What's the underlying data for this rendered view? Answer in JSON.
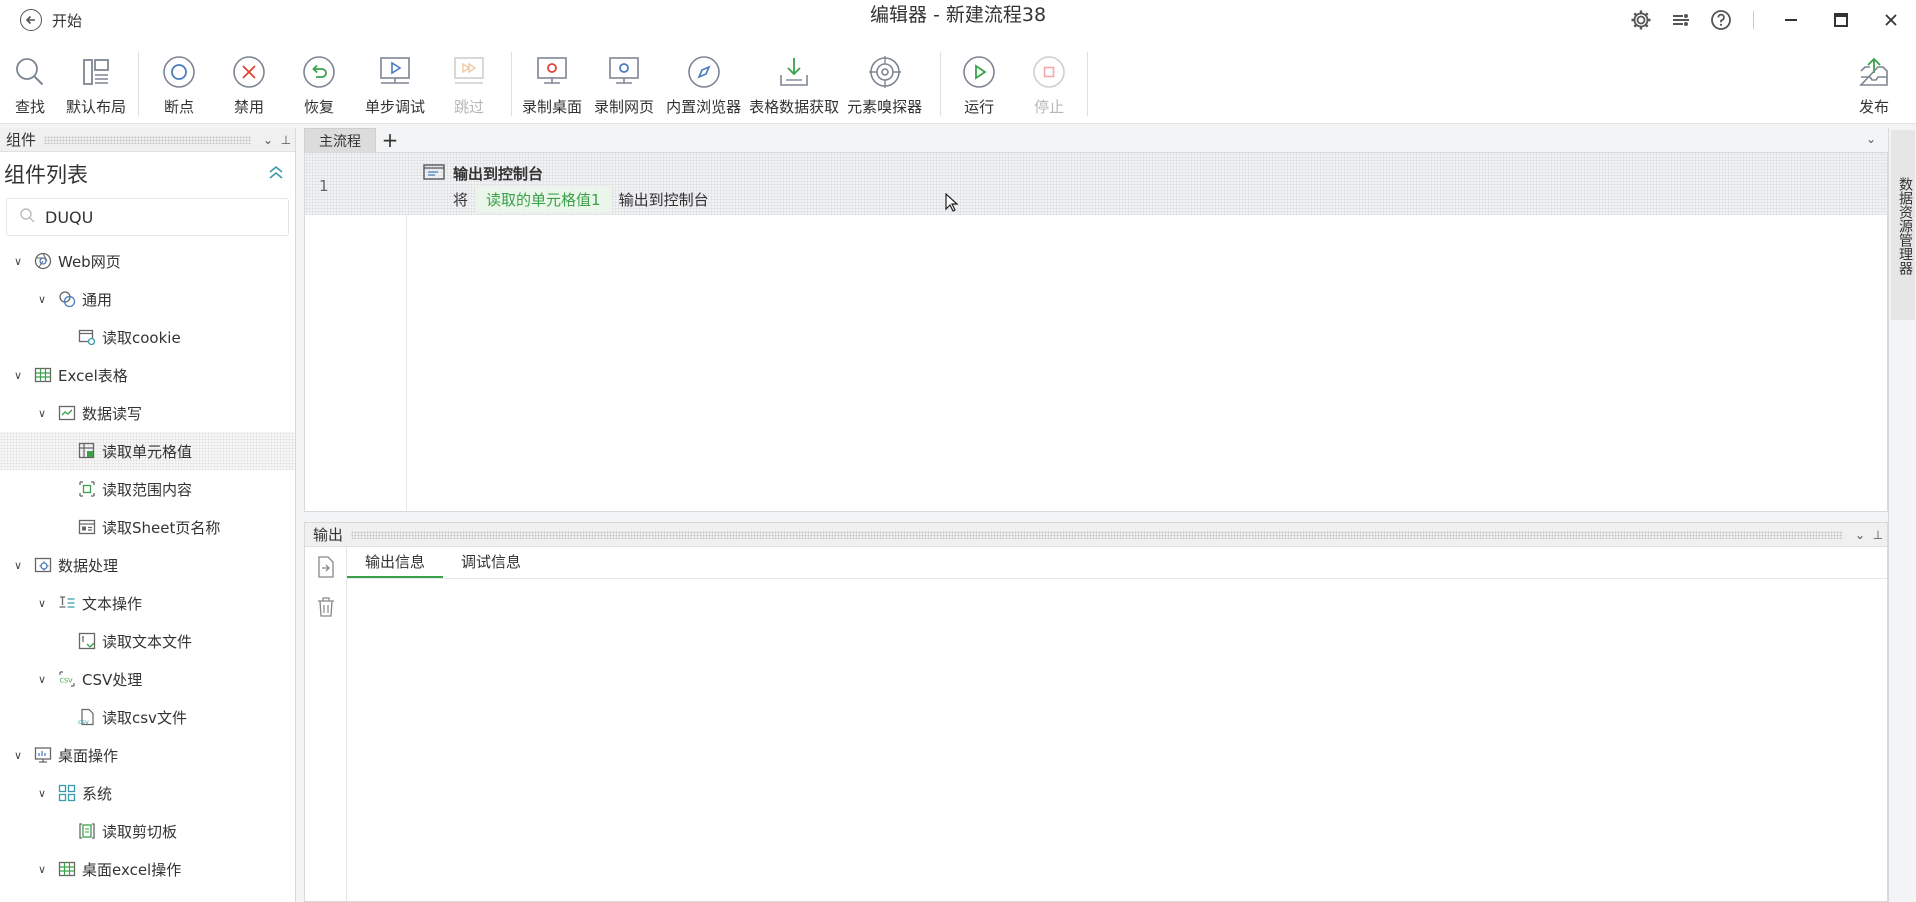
{
  "titlebar": {
    "back_label": "开始",
    "window_title": "编辑器 - 新建流程38"
  },
  "toolbar": {
    "find": "查找",
    "default_layout": "默认布局",
    "breakpoint": "断点",
    "disable": "禁用",
    "restore": "恢复",
    "step_debug": "单步调试",
    "skip": "跳过",
    "record_desktop": "录制桌面",
    "record_web": "录制网页",
    "builtin_browser": "内置浏览器",
    "table_fetch": "表格数据获取",
    "element_sniffer": "元素嗅探器",
    "run": "运行",
    "stop": "停止",
    "publish": "发布"
  },
  "left_panel": {
    "header": "组件",
    "title": "组件列表",
    "search_value": "DUQU",
    "tree": [
      {
        "label": "Web网页",
        "level": 0,
        "icon": "web-icon"
      },
      {
        "label": "通用",
        "level": 1,
        "icon": "general-icon"
      },
      {
        "label": "读取cookie",
        "level": 2,
        "icon": "cookie-icon"
      },
      {
        "label": "Excel表格",
        "level": 0,
        "icon": "excel-icon"
      },
      {
        "label": "数据读写",
        "level": 1,
        "icon": "data-rw-icon"
      },
      {
        "label": "读取单元格值",
        "level": 2,
        "icon": "cell-icon"
      },
      {
        "label": "读取范围内容",
        "level": 2,
        "icon": "range-icon"
      },
      {
        "label": "读取Sheet页名称",
        "level": 2,
        "icon": "sheet-icon"
      },
      {
        "label": "数据处理",
        "level": 0,
        "icon": "data-process-icon"
      },
      {
        "label": "文本操作",
        "level": 1,
        "icon": "text-op-icon"
      },
      {
        "label": "读取文本文件",
        "level": 2,
        "icon": "text-file-icon"
      },
      {
        "label": "CSV处理",
        "level": 1,
        "icon": "csv-icon"
      },
      {
        "label": "读取csv文件",
        "level": 2,
        "icon": "csv-file-icon"
      },
      {
        "label": "桌面操作",
        "level": 0,
        "icon": "desktop-icon"
      },
      {
        "label": "系统",
        "level": 1,
        "icon": "system-icon"
      },
      {
        "label": "读取剪切板",
        "level": 2,
        "icon": "clipboard-icon"
      },
      {
        "label": "桌面excel操作",
        "level": 1,
        "icon": "desktop-excel-icon"
      }
    ]
  },
  "editor": {
    "tab_main": "主流程",
    "tab_add": "+",
    "step": {
      "line_number": "1",
      "title": "输出到控制台",
      "prefix": "将",
      "variable": "读取的单元格值1",
      "suffix": "输出到控制台"
    }
  },
  "right_sidebar": {
    "label": "数据资源管理器"
  },
  "output": {
    "header": "输出",
    "tabs": [
      "输出信息",
      "调试信息"
    ]
  },
  "colors": {
    "accent_green": "#3aa14a",
    "chip_bg": "#eaf6ea",
    "icon_red": "#e0443c",
    "icon_blue": "#4a7dc0"
  }
}
